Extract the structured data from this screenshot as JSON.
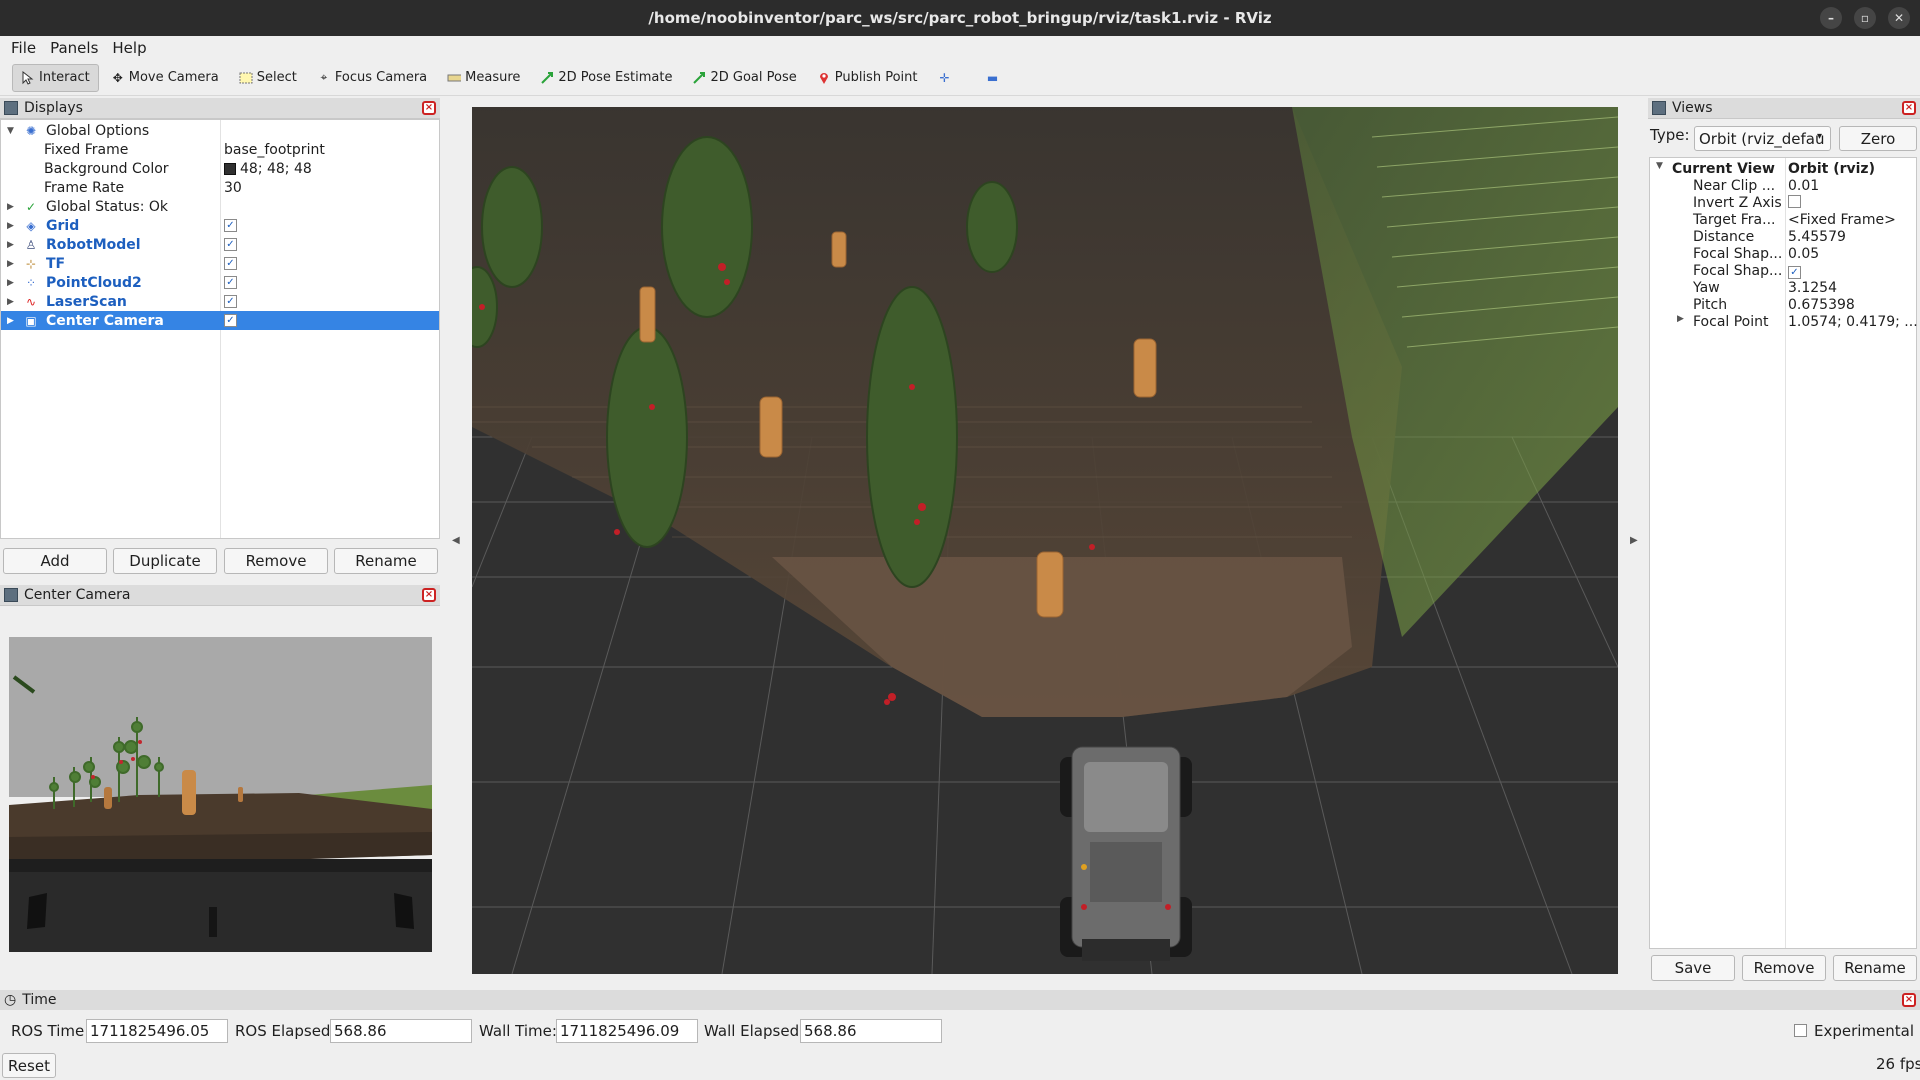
{
  "window": {
    "title": "/home/noobinventor/parc_ws/src/parc_robot_bringup/rviz/task1.rviz - RViz",
    "controls": {
      "minimize": "–",
      "maximize": "▫",
      "close": "✕"
    }
  },
  "menu": {
    "file": "File",
    "panels": "Panels",
    "help": "Help"
  },
  "toolbar": {
    "interact": "Interact",
    "move_camera": "Move Camera",
    "select": "Select",
    "focus_camera": "Focus Camera",
    "measure": "Measure",
    "pose_estimate": "2D Pose Estimate",
    "goal_pose": "2D Goal Pose",
    "publish_point": "Publish Point"
  },
  "displays": {
    "title": "Displays",
    "global_options": "Global Options",
    "fixed_frame_label": "Fixed Frame",
    "fixed_frame_value": "base_footprint",
    "bg_color_label": "Background Color",
    "bg_color_value": "48; 48; 48",
    "frame_rate_label": "Frame Rate",
    "frame_rate_value": "30",
    "global_status": "Global Status: Ok",
    "items": [
      "Grid",
      "RobotModel",
      "TF",
      "PointCloud2",
      "LaserScan",
      "Center Camera"
    ],
    "buttons": {
      "add": "Add",
      "duplicate": "Duplicate",
      "remove": "Remove",
      "rename": "Rename"
    }
  },
  "camera_panel": {
    "title": "Center Camera"
  },
  "views": {
    "title": "Views",
    "type_label": "Type:",
    "type_value": "Orbit (rviz_defau",
    "zero": "Zero",
    "current_view": "Current View",
    "current_view_value": "Orbit (rviz)",
    "props": [
      {
        "label": "Near Clip ...",
        "value": "0.01"
      },
      {
        "label": "Invert Z Axis",
        "value": ""
      },
      {
        "label": "Target Fra...",
        "value": "<Fixed Frame>"
      },
      {
        "label": "Distance",
        "value": "5.45579"
      },
      {
        "label": "Focal Shap...",
        "value": "0.05"
      },
      {
        "label": "Focal Shap...",
        "value": ""
      },
      {
        "label": "Yaw",
        "value": "3.1254"
      },
      {
        "label": "Pitch",
        "value": "0.675398"
      },
      {
        "label": "Focal Point",
        "value": "1.0574; 0.4179; ..."
      }
    ],
    "buttons": {
      "save": "Save",
      "remove": "Remove",
      "rename": "Rename"
    }
  },
  "time": {
    "title": "Time",
    "ros_time_label": "ROS Time:",
    "ros_time": "1711825496.05",
    "ros_elapsed_label": "ROS Elapsed:",
    "ros_elapsed": "568.86",
    "wall_time_label": "Wall Time:",
    "wall_time": "1711825496.09",
    "wall_elapsed_label": "Wall Elapsed:",
    "wall_elapsed": "568.86",
    "experimental": "Experimental",
    "reset": "Reset",
    "fps": "26 fps"
  }
}
